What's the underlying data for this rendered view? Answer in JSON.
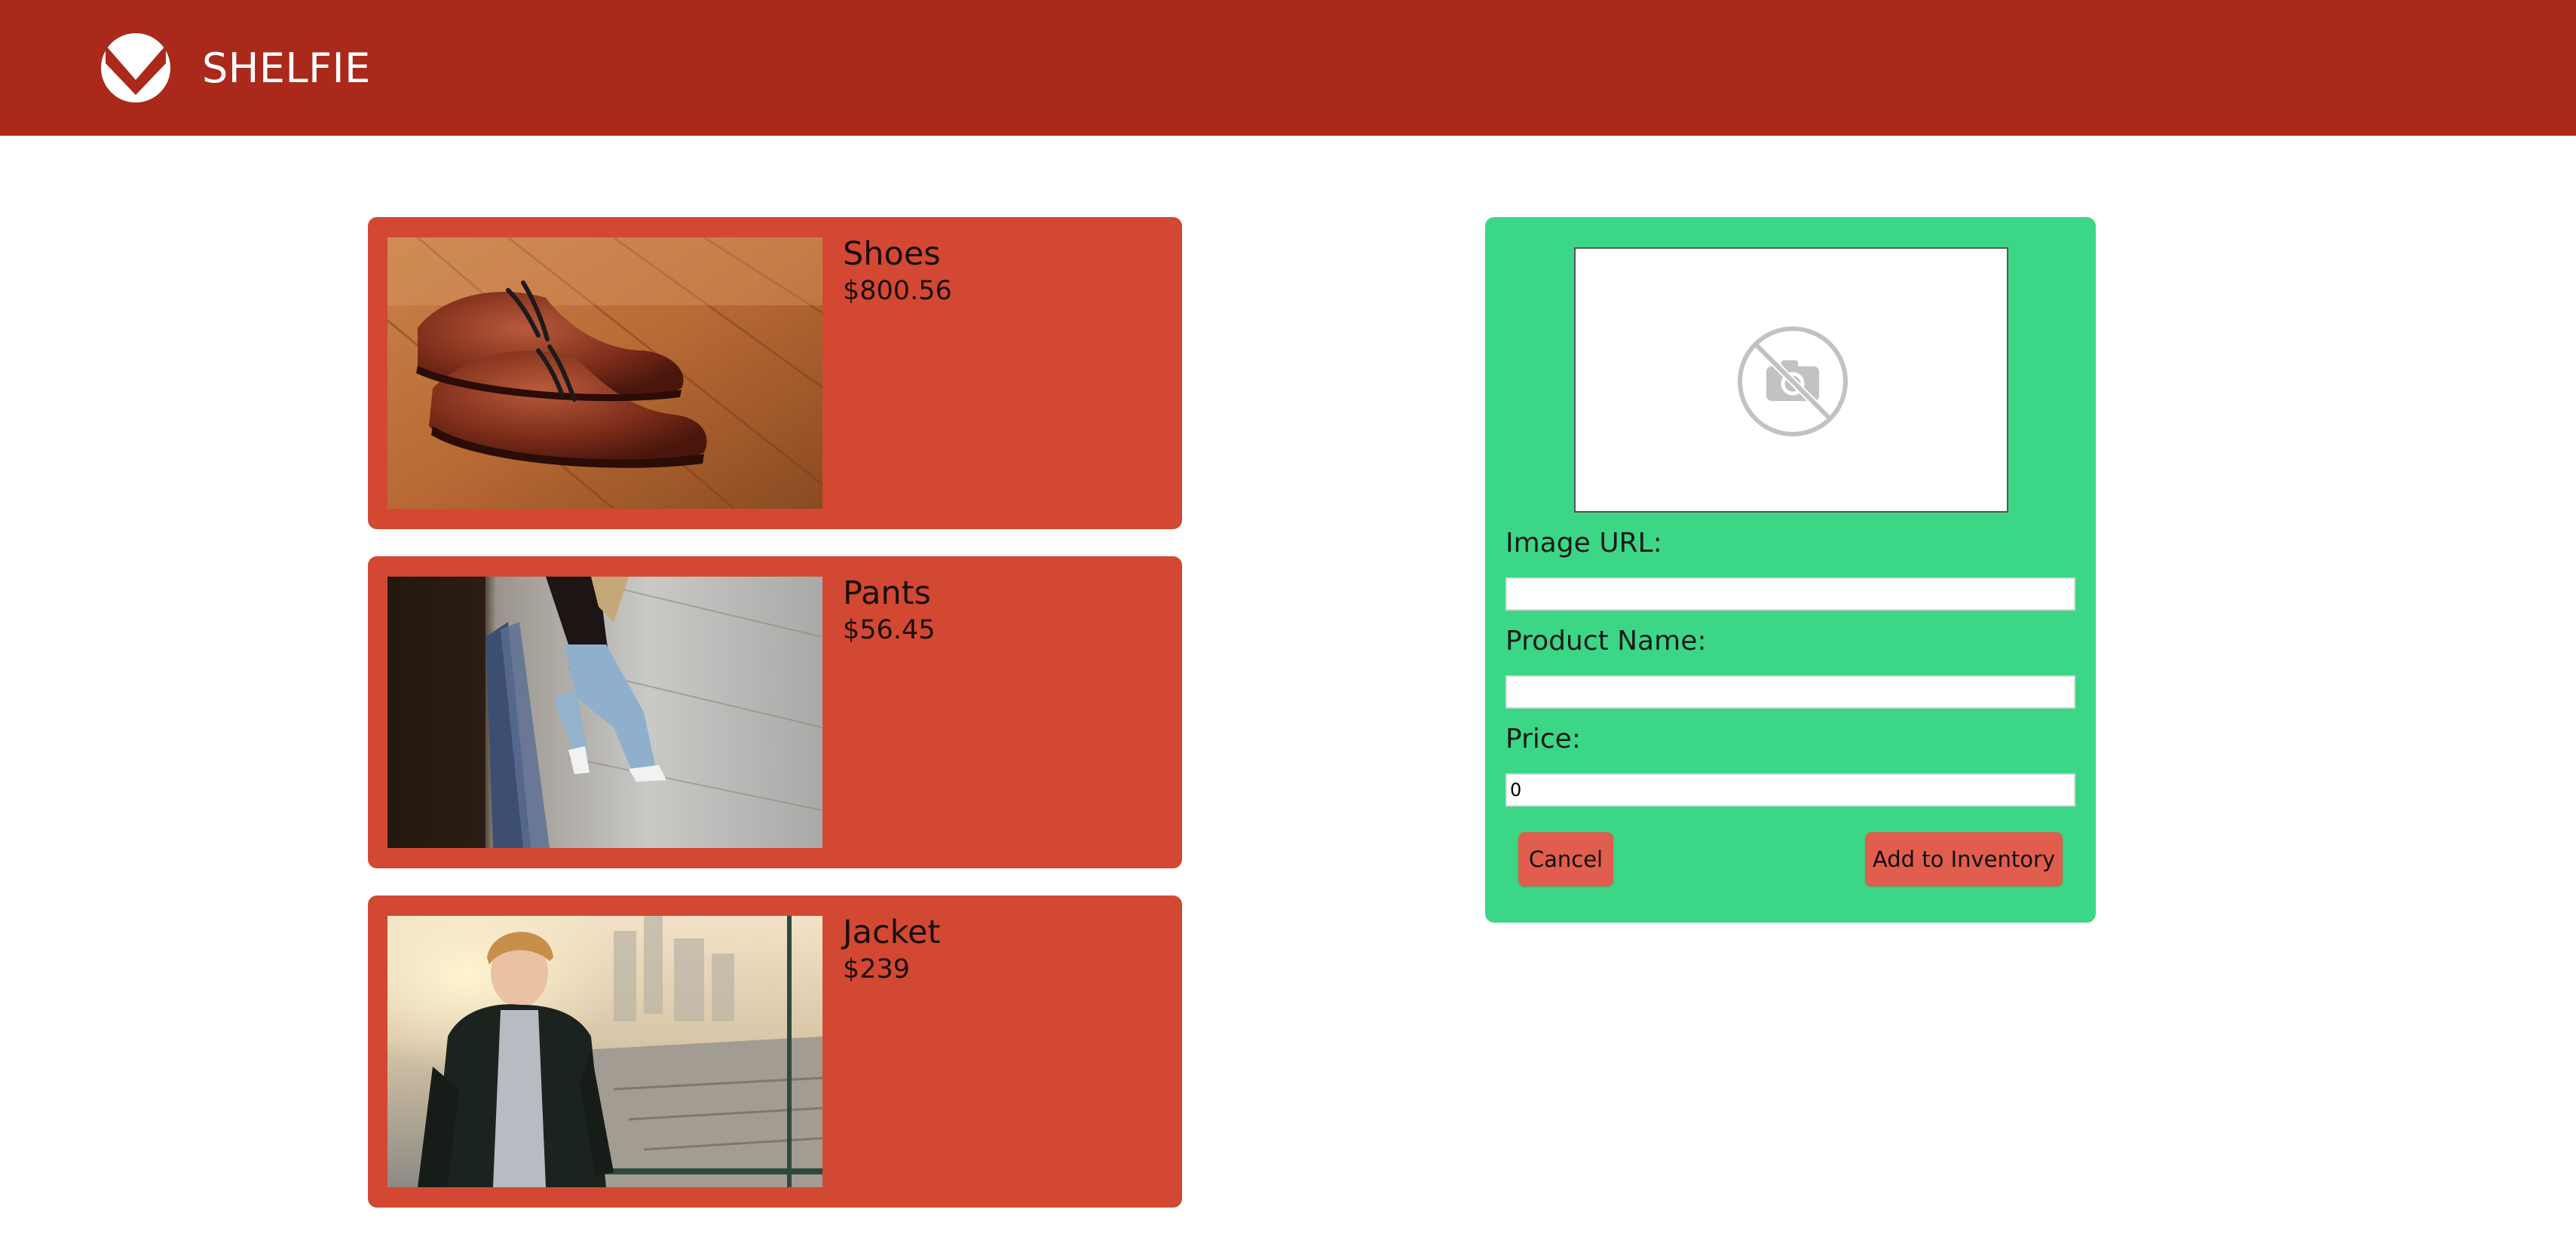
{
  "header": {
    "brand": "SHELFIE",
    "logo_icon": "shelfie-check-logo-icon",
    "bg_color": "#ab291b"
  },
  "products": [
    {
      "name": "Shoes",
      "price": "$800.56",
      "image": "brown-leather-shoes-photo"
    },
    {
      "name": "Pants",
      "price": "$56.45",
      "image": "person-in-jeans-photo"
    },
    {
      "name": "Jacket",
      "price": "$239",
      "image": "man-in-jacket-photo"
    }
  ],
  "form": {
    "preview_icon": "no-camera-icon",
    "image_url_label": "Image URL:",
    "image_url_value": "",
    "product_name_label": "Product Name:",
    "product_name_value": "",
    "price_label": "Price:",
    "price_value": "0",
    "cancel_label": "Cancel",
    "add_label": "Add to Inventory",
    "bg_color": "#3bd787"
  },
  "colors": {
    "card": "#d34833",
    "button": "#e15d4d"
  }
}
